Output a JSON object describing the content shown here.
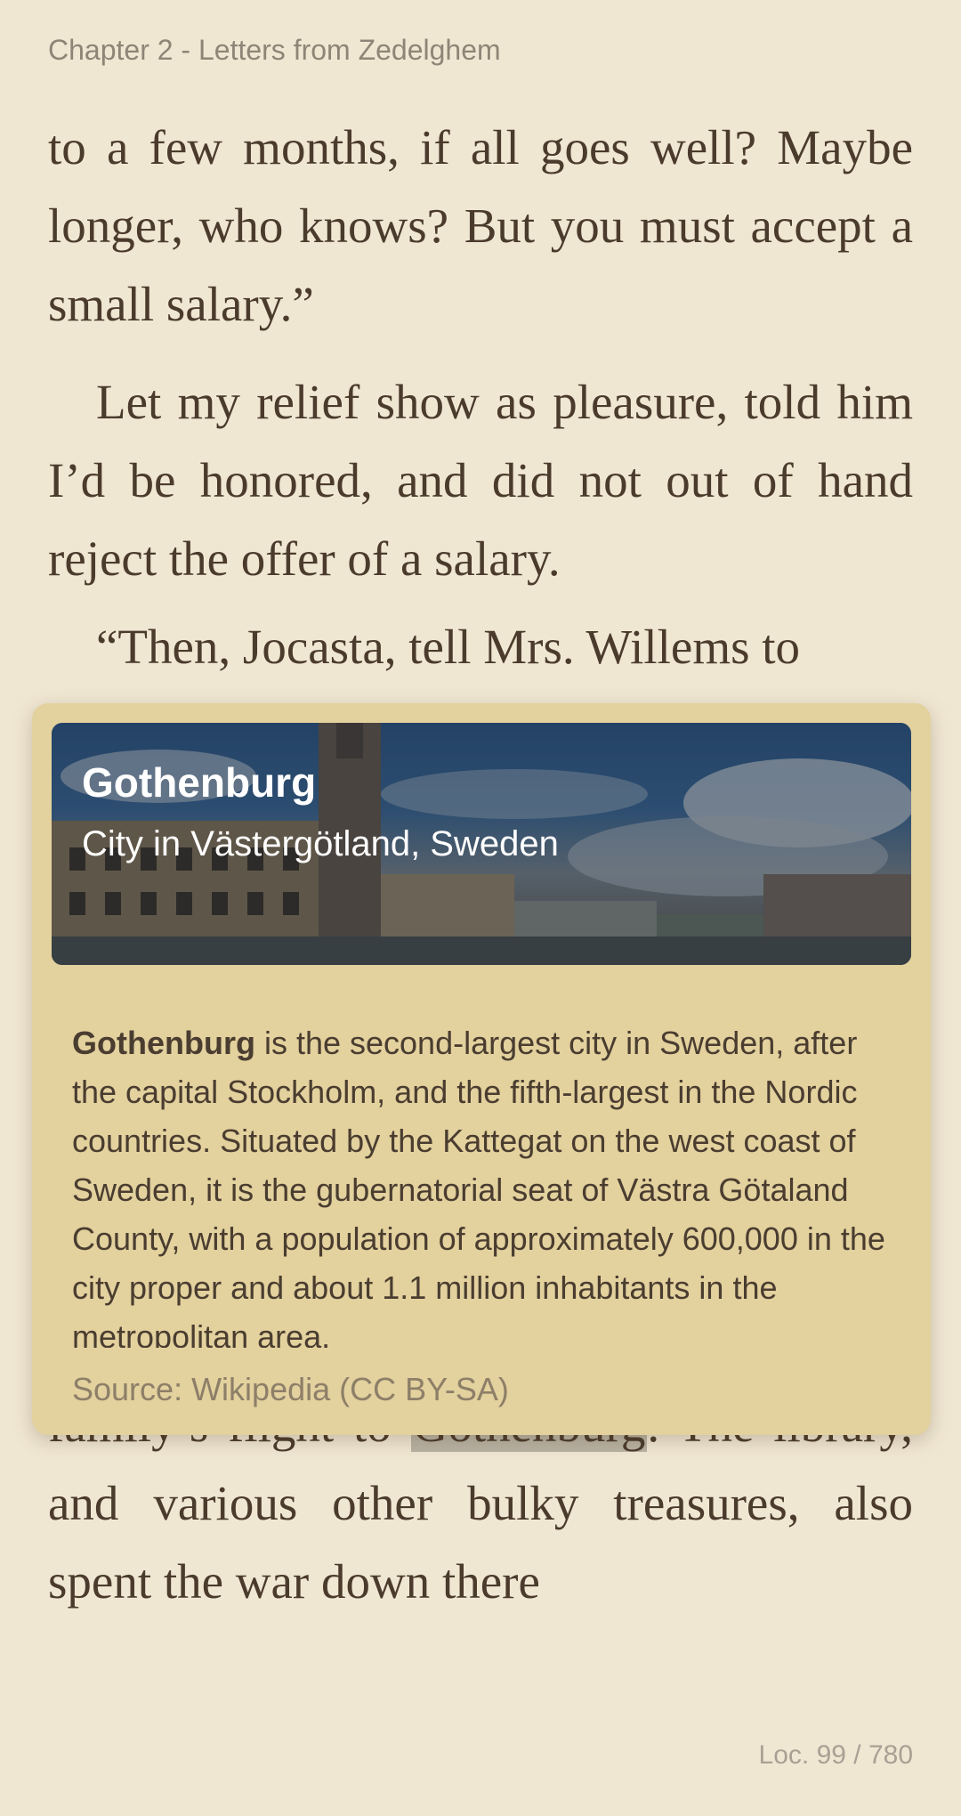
{
  "reader": {
    "chapter_title": "Chapter 2 - Letters from Zedelghem",
    "location": "Loc. 99 / 780"
  },
  "text": {
    "p1": "to a few months, if all goes well? Maybe longer, who knows? But you must accept a small salary.”",
    "p2": "Let my relief show as pleasure, told him I’d be honored, and did not out of hand reject the offer of a salary.",
    "p3": "“Then, Jocasta, tell Mrs. Willems to",
    "p4_before": "family’s flight to ",
    "p4_highlight": "Gothenburg",
    "p4_after": ". The li­brary, and various other bulky trea­sures, also spent the war down there"
  },
  "popup": {
    "title": "Gothenburg",
    "subtitle": "City in Västergötland, Sweden",
    "summary_bold": "Gothenburg",
    "summary_rest": " is the second-largest city in Sweden, after the capital Stockholm, and the fifth-largest in the Nordic countries. Situated by the Kattegat on the west coast of Sweden, it is the gubernatorial seat of Västra Götaland County, with a population of approximately 600,000 in the city proper and about 1.1 million inhabitants in the metropolitan area.",
    "source": "Source: Wikipedia (CC BY-SA)"
  },
  "colors": {
    "page_background": "#f0e7d3",
    "popup_background": "#e3d19e",
    "highlight": "#b9b2a4"
  }
}
